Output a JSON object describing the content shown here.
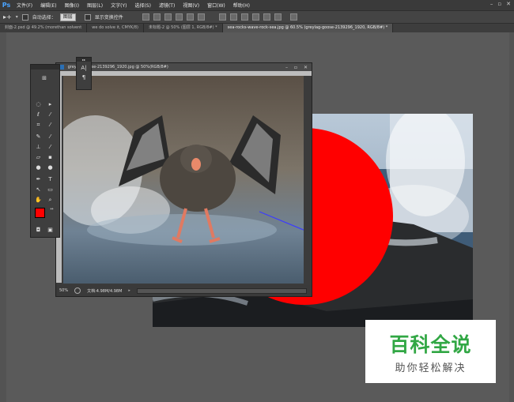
{
  "app": {
    "logo": "Ps"
  },
  "menu": [
    "文件(F)",
    "编辑(E)",
    "图像(I)",
    "图层(L)",
    "文字(Y)",
    "选择(S)",
    "滤镜(T)",
    "视图(V)",
    "窗口(W)",
    "帮助(H)"
  ],
  "window_controls": [
    "–",
    "▫",
    "✕"
  ],
  "options_bar": {
    "auto_select_label": "自动选择：",
    "auto_select_value": "图层",
    "show_transform_label": "显示变换控件"
  },
  "tabs": [
    "封面-2.psd @ 49.2% (morethan solvent",
    "we do solve it, CMYK/8)",
    "未标题-2 @ 50% (图层 1, RGB/8#) *",
    "sea-rocks-wave-rock-sea.jpg @ 60.5% (greylag-goose-2139296_1920, RGB/8#) *"
  ],
  "doc_window": {
    "title": "greylag-goose-2139296_1920.jpg @ 50%(RGB/8#)",
    "zoom": "50%",
    "doc_info": "文档:4.98M/4.98M"
  },
  "char_panel": {
    "char_glyph": "A|",
    "para_glyph": "¶"
  },
  "colors": {
    "foreground": "#ff0000",
    "background": "#ffffff",
    "circle": "#ff0000"
  },
  "watermark": {
    "title": "百科全说",
    "subtitle": "助你轻松解决"
  }
}
